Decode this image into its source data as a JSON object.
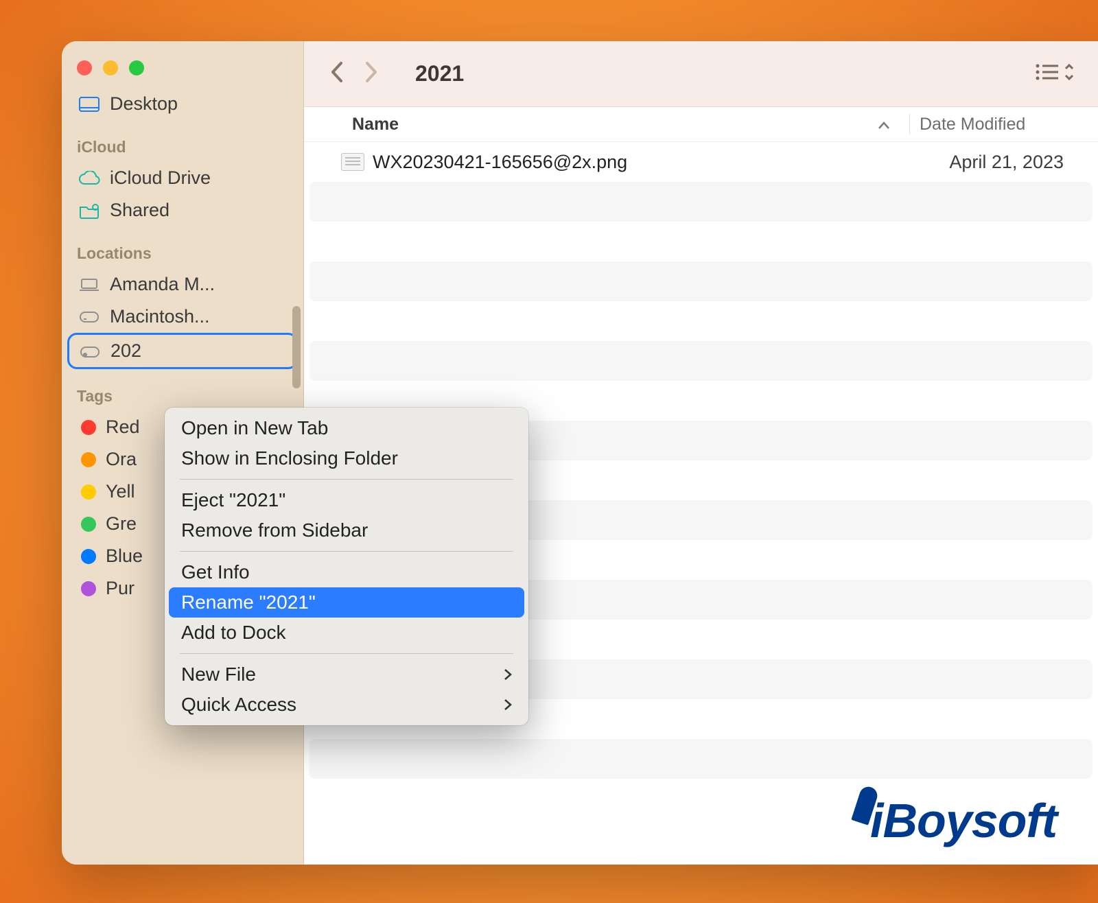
{
  "toolbar": {
    "title": "2021",
    "back_icon": "chevron-left",
    "forward_icon": "chevron-right",
    "view_icon": "list-view"
  },
  "sidebar": {
    "desktop_label": "Desktop",
    "sections": {
      "icloud": "iCloud",
      "locations": "Locations",
      "tags": "Tags"
    },
    "icloud_items": [
      {
        "label": "iCloud Drive",
        "icon": "cloud"
      },
      {
        "label": "Shared",
        "icon": "shared-folder"
      }
    ],
    "location_items": [
      {
        "label": "Amanda M...",
        "icon": "laptop"
      },
      {
        "label": "Macintosh...",
        "icon": "disk"
      },
      {
        "label": "202",
        "icon": "disk-image",
        "selected": true
      }
    ],
    "tags": [
      {
        "label": "Red",
        "color": "#ff3b30"
      },
      {
        "label": "Ora",
        "color": "#ff9500"
      },
      {
        "label": "Yell",
        "color": "#ffcc00"
      },
      {
        "label": "Gre",
        "color": "#34c759"
      },
      {
        "label": "Blue",
        "color": "#007aff"
      },
      {
        "label": "Pur",
        "color": "#af52de"
      }
    ]
  },
  "columns": {
    "name": "Name",
    "date": "Date Modified"
  },
  "files": [
    {
      "name": "WX20230421-165656@2x.png",
      "date": "April 21, 2023"
    }
  ],
  "context_menu": {
    "items": [
      {
        "label": "Open in New Tab"
      },
      {
        "label": "Show in Enclosing Folder"
      },
      {
        "sep": true
      },
      {
        "label": "Eject \"2021\""
      },
      {
        "label": "Remove from Sidebar"
      },
      {
        "sep": true
      },
      {
        "label": "Get Info"
      },
      {
        "label": "Rename \"2021\"",
        "highlighted": true
      },
      {
        "label": "Add to Dock"
      },
      {
        "sep": true
      },
      {
        "label": "New File",
        "submenu": true
      },
      {
        "label": "Quick Access",
        "submenu": true
      }
    ]
  },
  "watermark": "iBoysoft"
}
